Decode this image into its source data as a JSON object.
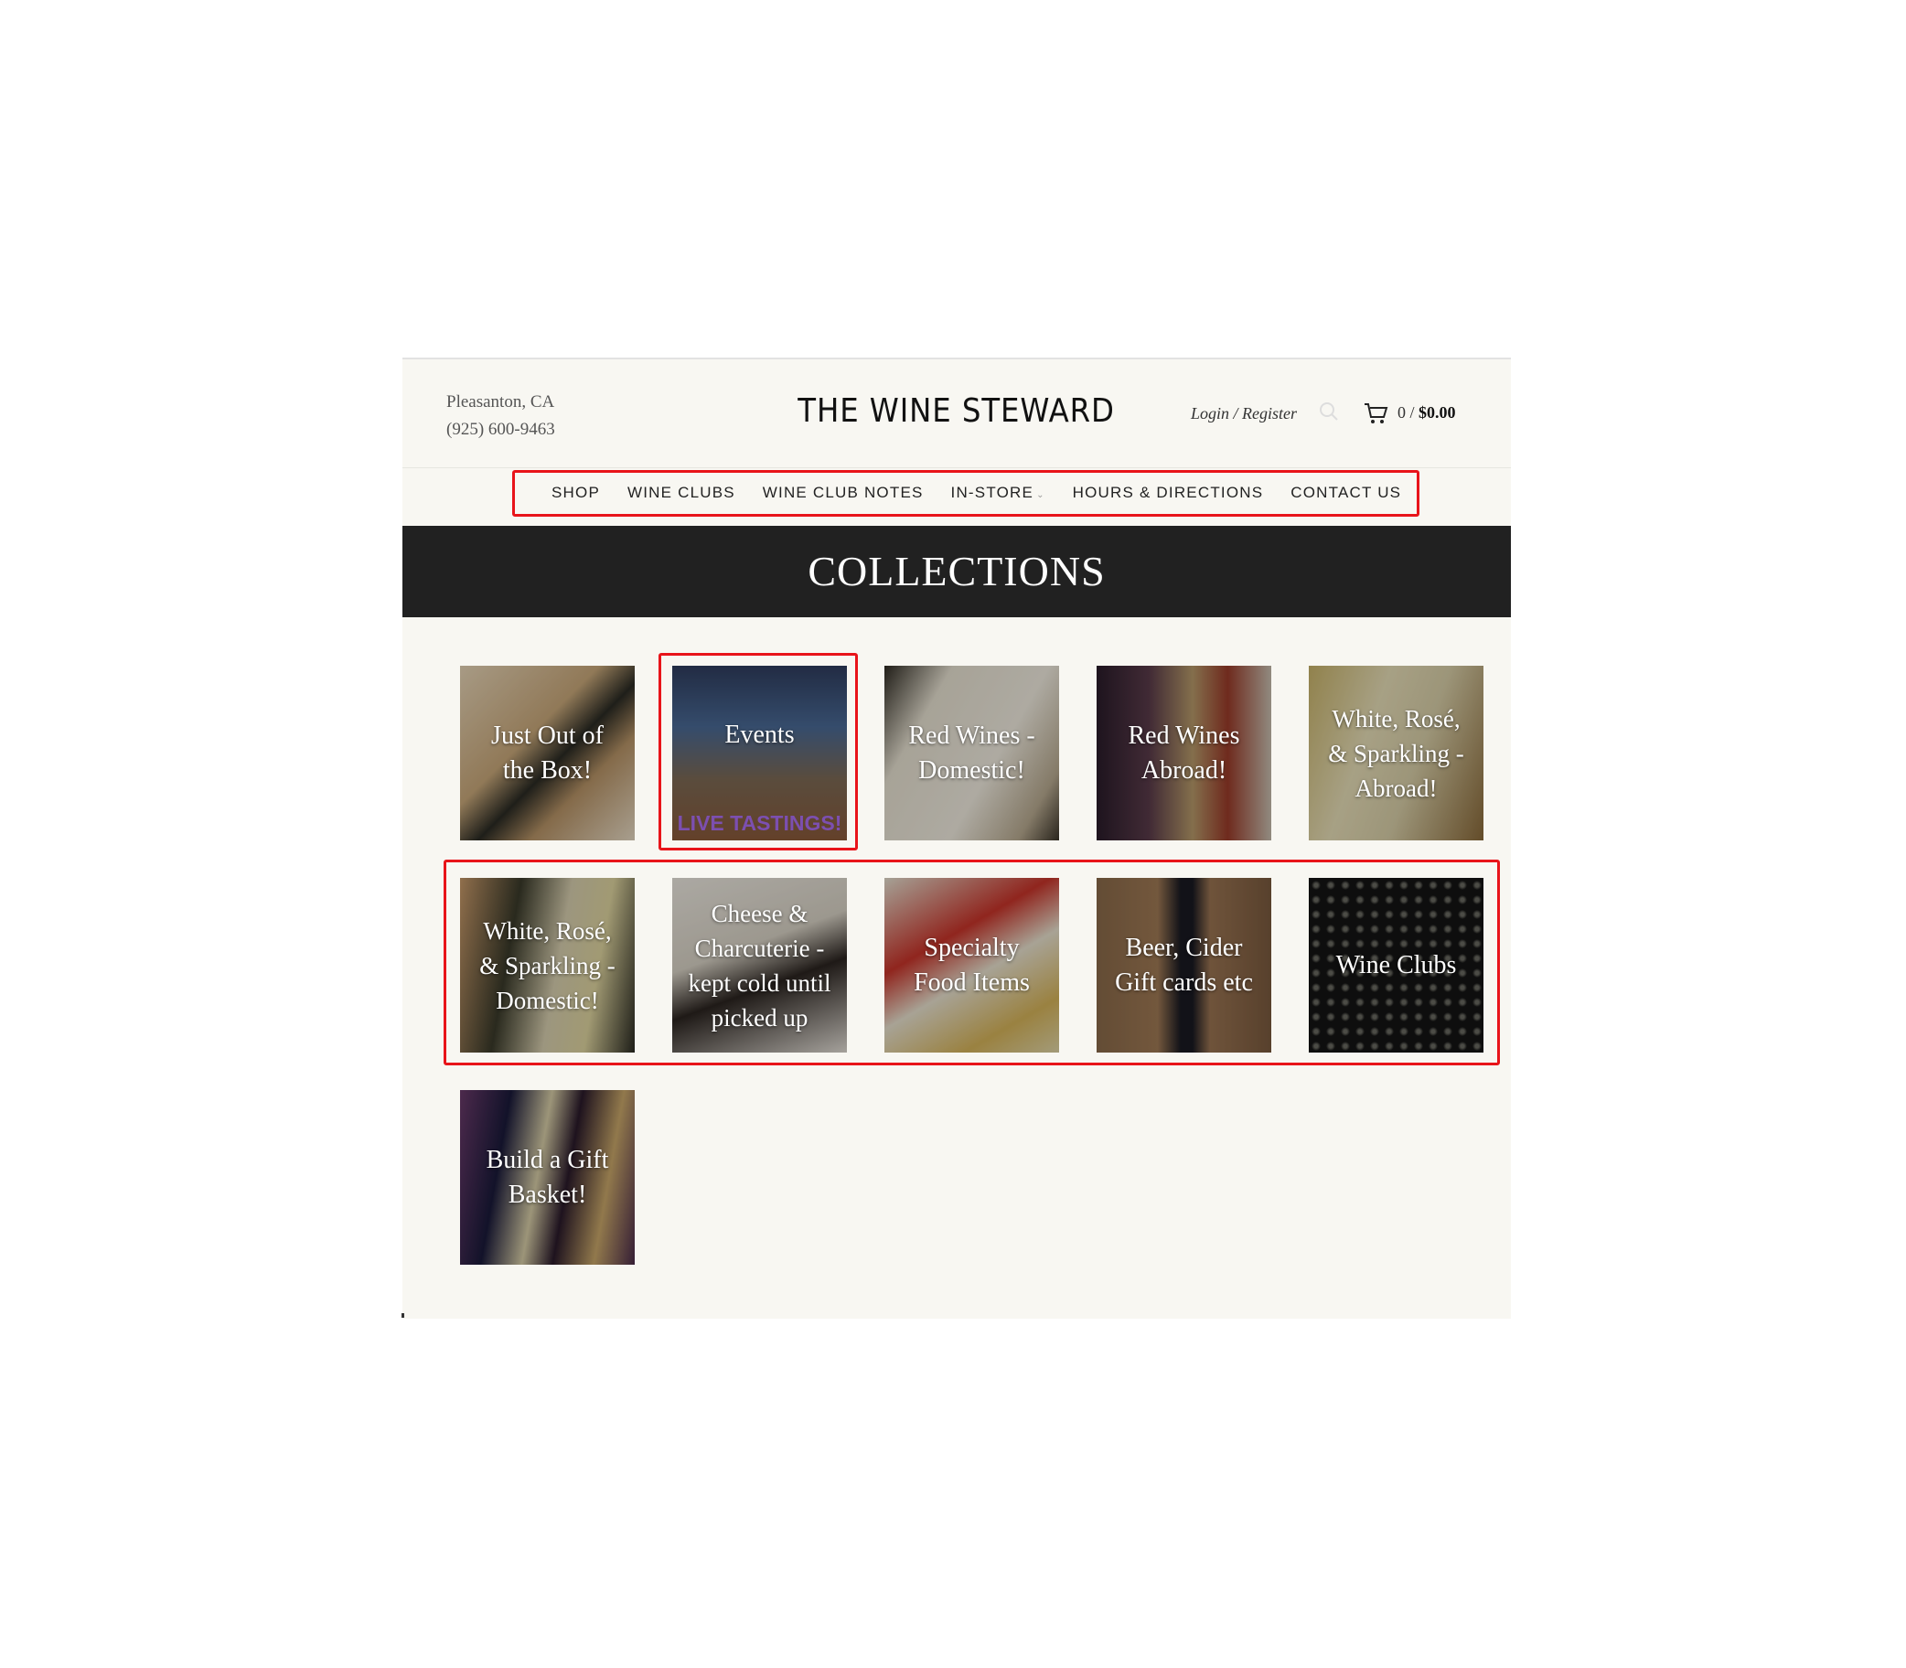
{
  "header": {
    "location": "Pleasanton, CA",
    "phone": "(925) 600-9463",
    "logo": "THE WINE STEWARD",
    "login": "Login / Register",
    "cart_count": "0",
    "cart_sep": " / ",
    "cart_total": "$0.00"
  },
  "nav": {
    "items": [
      "SHOP",
      "WINE CLUBS",
      "WINE CLUB NOTES",
      "IN-STORE",
      "HOURS & DIRECTIONS",
      "CONTACT US"
    ]
  },
  "banner": {
    "title": "COLLECTIONS"
  },
  "collections": [
    {
      "label": "Just Out of the Box!"
    },
    {
      "label": "Events",
      "extra": "LIVE TASTINGS!"
    },
    {
      "label": "Red Wines - Domestic!"
    },
    {
      "label": "Red Wines Abroad!"
    },
    {
      "label": "White, Rosé, & Sparkling - Abroad!"
    },
    {
      "label": "White, Rosé, & Sparkling - Domestic!"
    },
    {
      "label": "Cheese & Charcuterie -kept cold until picked up"
    },
    {
      "label": "Specialty Food Items"
    },
    {
      "label": "Beer, Cider Gift cards etc"
    },
    {
      "label": "Wine Clubs"
    },
    {
      "label": "Build a Gift Basket!"
    }
  ],
  "colors": {
    "highlight": "#e8141a",
    "banner": "#212121",
    "page_bg": "#f8f7f2"
  }
}
